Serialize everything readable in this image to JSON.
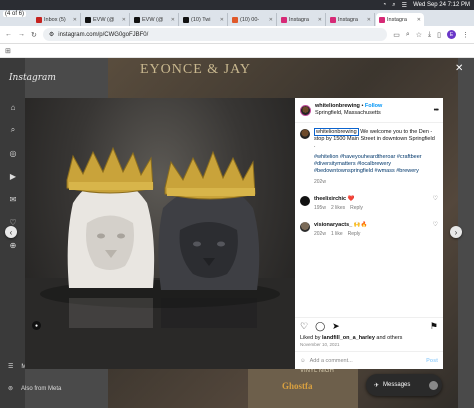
{
  "menubar": {
    "datetime": "Wed Sep 24  7:12 PM"
  },
  "tabs": {
    "counter": "(4 of 6)",
    "items": [
      {
        "label": "Inbox (5)",
        "color": "#c5221f"
      },
      {
        "label": "EVW (@",
        "color": "#111111"
      },
      {
        "label": "EVW (@",
        "color": "#111111"
      },
      {
        "label": "(10) Twi",
        "color": "#111111"
      },
      {
        "label": "(10) 00-",
        "color": "#e0592a"
      },
      {
        "label": "Instagra",
        "color": "#d62976"
      },
      {
        "label": "Instagra",
        "color": "#d62976"
      },
      {
        "label": "Instagra",
        "color": "#d62976"
      }
    ]
  },
  "address": {
    "url": "instagram.com/p/CWG0goFJBF0/",
    "profile_initial": "E"
  },
  "sidebar": {
    "logo": "Instagram",
    "more_label": "More",
    "meta_label": "Also from Meta"
  },
  "background": {
    "headline": "EYONCE & JAY",
    "bottom_text_1": "VINYL NIGH",
    "bottom_text_2": "Ghostfa"
  },
  "messages": {
    "label": "Messages"
  },
  "post": {
    "account": "whitelionbrewing",
    "follow_label": "Follow",
    "location": "Springfield, Massachusetts",
    "caption_user": "whitelionbrewing",
    "caption_text": " We welcome you to the Den - stop by 1500 Main Street in downtown Springfield",
    "caption_dots": ".",
    "hashtags": "#whitelion #haveyouheardtheroar #craftbeer #diversitymatters #localbrewery #bedowntownspringfield #wmass #brewery",
    "caption_age": "202w",
    "comments": [
      {
        "user": "theelixirchic",
        "text": "❤️",
        "age": "195w",
        "likes": "2 likes",
        "reply": "Reply"
      },
      {
        "user": "visionaryacts_",
        "text": "🙌🔥",
        "age": "202w",
        "likes": "1 like",
        "reply": "Reply"
      }
    ],
    "liked_prefix": "Liked by ",
    "liked_user": "landfill_on_a_harley",
    "liked_suffix": " and others",
    "date": "November 10, 2021",
    "add_comment_placeholder": "Add a comment...",
    "post_label": "Post"
  },
  "colors": {
    "accent": "#0095f6",
    "hashtag": "#00376b"
  }
}
